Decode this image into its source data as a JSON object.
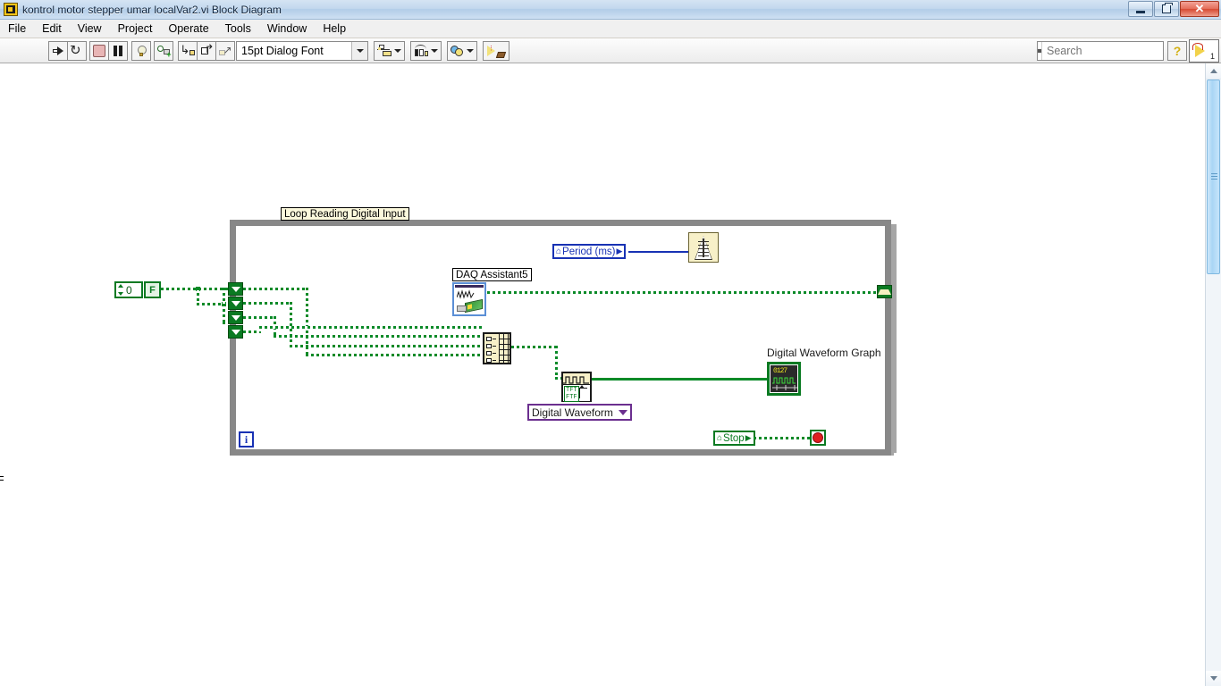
{
  "window": {
    "title": "kontrol motor stepper umar localVar2.vi Block Diagram",
    "icon": "labview-vi-icon",
    "buttons": {
      "minimize": "minimize",
      "restore": "restore",
      "close": "✕"
    }
  },
  "menu": {
    "items": [
      "File",
      "Edit",
      "View",
      "Project",
      "Operate",
      "Tools",
      "Window",
      "Help"
    ]
  },
  "toolbar": {
    "run": "run-arrow-button",
    "run_continuously": "run-continuously-button",
    "abort": "abort-execution-button",
    "pause": "pause-button",
    "highlight": "highlight-execution-button",
    "retain_values": "retain-wire-values-button",
    "step_into": "step-into-button",
    "step_over": "step-over-button",
    "step_out": "step-out-button",
    "font": "15pt Dialog Font",
    "align": "align-objects-button",
    "distribute": "distribute-objects-button",
    "reorder": "reorder-button",
    "cleanup": "cleanup-diagram-button",
    "help_label": "?",
    "context_help_number": "1"
  },
  "search": {
    "placeholder": "Search",
    "value": ""
  },
  "diagram": {
    "loop_label": "Loop Reading Digital Input",
    "numeric_constant": "0",
    "boolean_constant": "F",
    "period_local": {
      "label": "Period (ms)",
      "home": "⌂",
      "arrow": "▶"
    },
    "daq_label": "DAQ Assistant5",
    "enum_constant": "Digital Waveform",
    "graph_label": "Digital Waveform Graph",
    "stop_local": {
      "label": "Stop",
      "home": "⌂",
      "arrow": "▶"
    },
    "iteration_terminal": "i",
    "graph_digits": "0127",
    "dwf_row1": "TFT",
    "dwf_row2": "FTF",
    "colors": {
      "wire_green": "#0a8a28",
      "wire_blue": "#1832b4",
      "loop_border": "#888888",
      "local_blue": "#1832b4",
      "local_green": "#0a7a22",
      "enum_purple": "#6b2f8f",
      "label_yellow": "#fbf8dc"
    }
  },
  "scrollbar": {
    "up": "scroll-up-arrow",
    "down": "scroll-down-arrow"
  }
}
